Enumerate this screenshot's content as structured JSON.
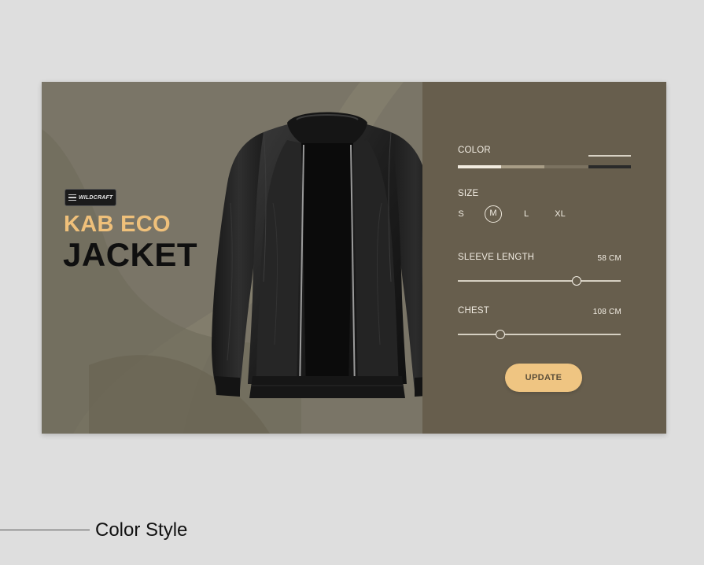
{
  "product": {
    "logo_text": "WILDCRAFT",
    "brand_line": "KAB ECO",
    "name_line": "JACKET"
  },
  "options": {
    "color": {
      "label": "COLOR",
      "swatches": [
        "#f1ebdf",
        "#a89d86",
        "#7b7260",
        "#2a2a2a"
      ],
      "selected_index": 3
    },
    "size": {
      "label": "SIZE",
      "choices": [
        "S",
        "M",
        "L",
        "XL"
      ],
      "selected": "M"
    },
    "sleeve_length": {
      "label": "SLEEVE LENGTH",
      "value": "58 CM",
      "fraction": 0.73
    },
    "chest": {
      "label": "CHEST",
      "value": "108 CM",
      "fraction": 0.26
    }
  },
  "actions": {
    "update_label": "UPDATE"
  },
  "caption": {
    "text": "Color Style"
  },
  "colors": {
    "page_bg": "#dedede",
    "left_panel": "#7a7567",
    "right_panel": "#675e4d",
    "accent": "#efc07a",
    "button": "#efc582"
  }
}
